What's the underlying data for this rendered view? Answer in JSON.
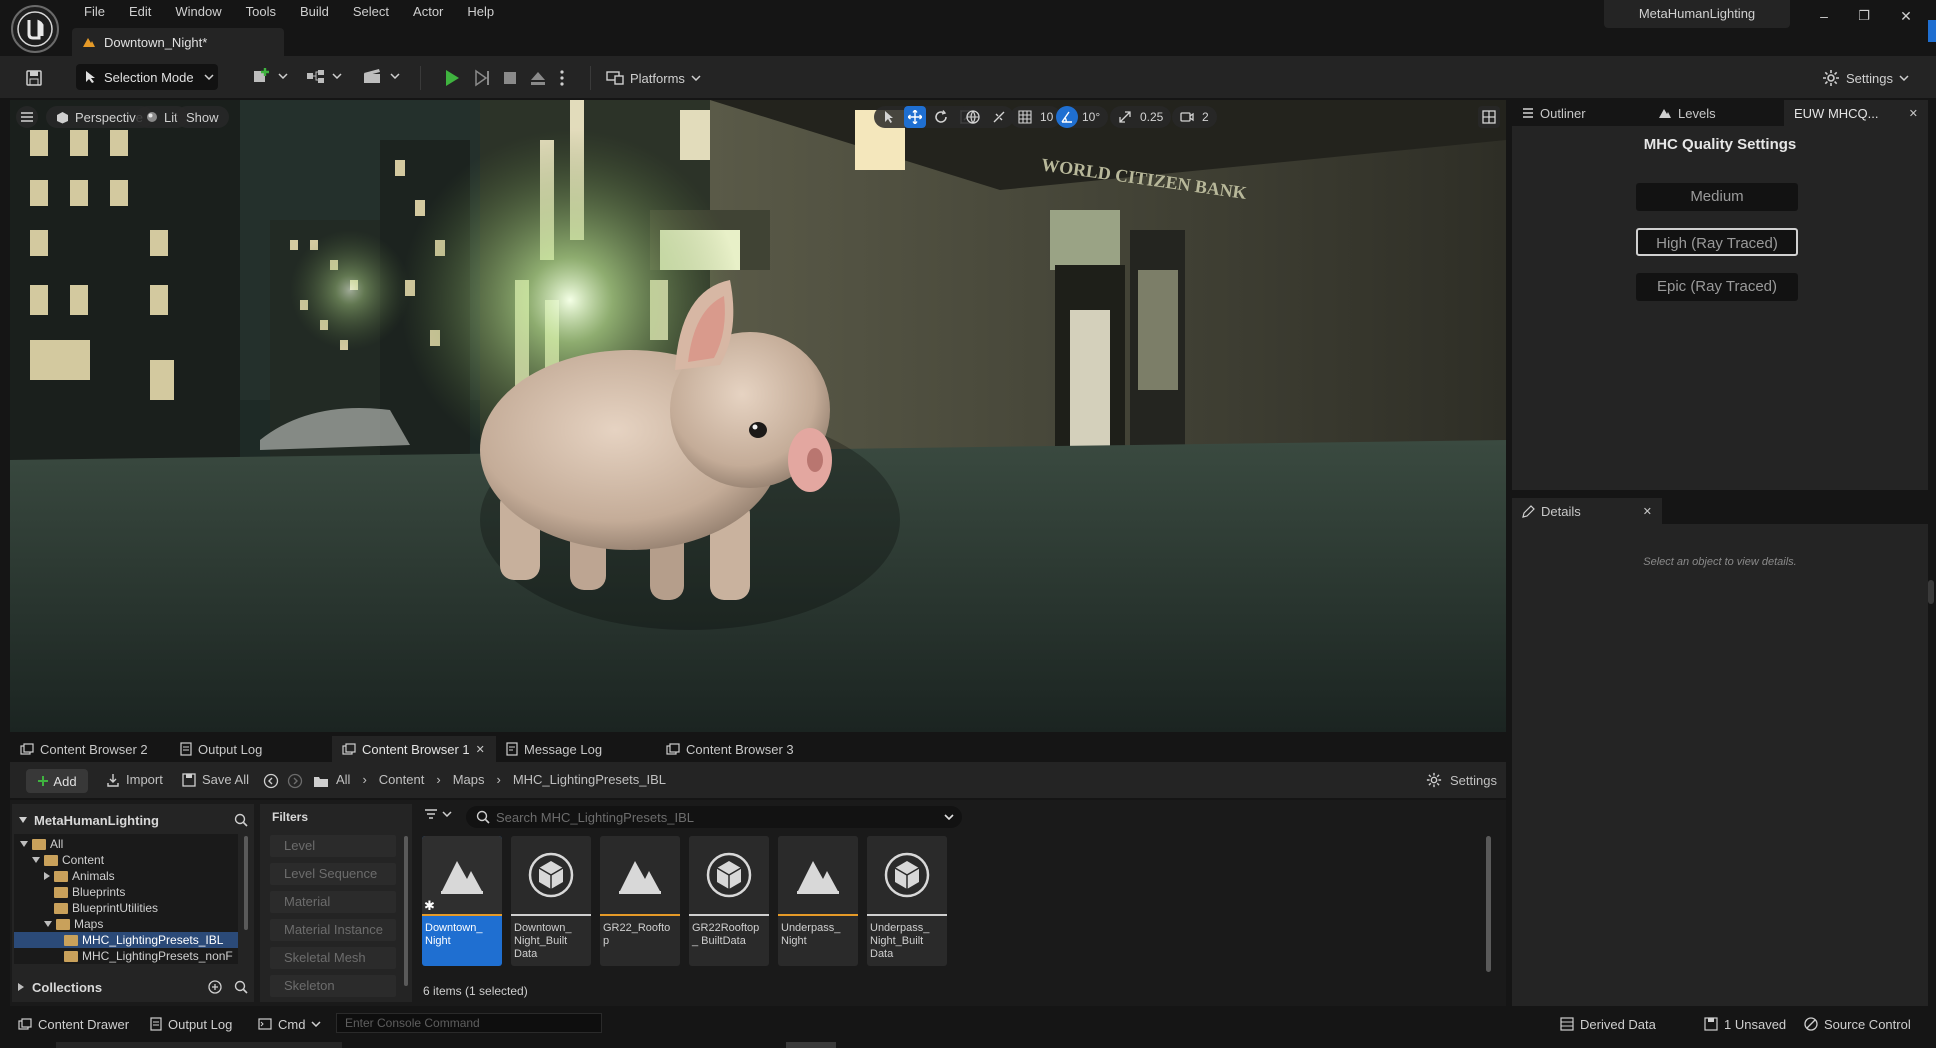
{
  "window": {
    "project_name": "MetaHumanLighting",
    "minimize": "–",
    "restore": "❐",
    "close": "✕"
  },
  "menu": [
    "File",
    "Edit",
    "Window",
    "Tools",
    "Build",
    "Select",
    "Actor",
    "Help"
  ],
  "document_tab": {
    "label": "Downtown_Night*"
  },
  "toolbar": {
    "selection_mode": "Selection Mode",
    "platforms": "Platforms",
    "settings": "Settings"
  },
  "viewport": {
    "perspective": "Perspective",
    "lit": "Lit",
    "show": "Show",
    "grid_snap": "10",
    "rotation_snap": "10°",
    "scale_snap": "0.25",
    "camera_speed": "2",
    "sign_text": "WORLD CITIZEN BANK"
  },
  "right_tabs": {
    "outliner": "Outliner",
    "levels": "Levels",
    "euw": "EUW MHCQ...",
    "close": "✕"
  },
  "mhc": {
    "title": "MHC Quality Settings",
    "options": [
      "Medium",
      "High (Ray Traced)",
      "Epic (Ray Traced)"
    ],
    "selected": "High (Ray Traced)"
  },
  "details": {
    "tab": "Details",
    "close": "✕",
    "hint": "Select an object to view details."
  },
  "bottom_tabs": [
    {
      "label": "Content Browser 2"
    },
    {
      "label": "Output Log"
    },
    {
      "label": "Content Browser 1",
      "close": "✕"
    },
    {
      "label": "Message Log"
    },
    {
      "label": "Content Browser 3"
    }
  ],
  "cb_toolbar": {
    "add": "Add",
    "import": "Import",
    "save_all": "Save All",
    "breadcrumb": [
      "All",
      "Content",
      "Maps",
      "MHC_LightingPresets_IBL"
    ],
    "settings": "Settings"
  },
  "tree": {
    "root": "MetaHumanLighting",
    "items": [
      {
        "label": "All",
        "depth": 0
      },
      {
        "label": "Content",
        "depth": 1
      },
      {
        "label": "Animals",
        "depth": 2
      },
      {
        "label": "Blueprints",
        "depth": 2
      },
      {
        "label": "BlueprintUtilities",
        "depth": 2
      },
      {
        "label": "Maps",
        "depth": 2
      },
      {
        "label": "MHC_LightingPresets_IBL",
        "depth": 3
      },
      {
        "label": "MHC_LightingPresets_nonF",
        "depth": 3
      }
    ],
    "selected": "MHC_LightingPresets_IBL",
    "collections": "Collections"
  },
  "filters": {
    "title": "Filters",
    "items": [
      "Level",
      "Level Sequence",
      "Material",
      "Material Instance",
      "Skeletal Mesh",
      "Skeleton"
    ]
  },
  "search": {
    "placeholder": "Search MHC_LightingPresets_IBL"
  },
  "assets": [
    {
      "label": "Downtown_ Night",
      "kind": "level",
      "selected": true
    },
    {
      "label": "Downtown_ Night_Built Data",
      "kind": "data"
    },
    {
      "label": "GR22_Rooftop",
      "kind": "level"
    },
    {
      "label": "GR22Rooftop_ BuiltData",
      "kind": "data"
    },
    {
      "label": "Underpass_ Night",
      "kind": "level"
    },
    {
      "label": "Underpass_ Night_Built Data",
      "kind": "data"
    }
  ],
  "asset_count": "6 items (1 selected)",
  "statusbar": {
    "content_drawer": "Content Drawer",
    "output_log": "Output Log",
    "cmd": "Cmd",
    "console_placeholder": "Enter Console Command",
    "derived_data": "Derived Data",
    "unsaved": "1 Unsaved",
    "source_control": "Source Control"
  },
  "colors": {
    "accent_blue": "#1f6fd1",
    "play_green": "#3fb33f",
    "level_bar": "#e59a28",
    "data_bar": "#cfcfcf",
    "folder": "#c9a15b"
  }
}
